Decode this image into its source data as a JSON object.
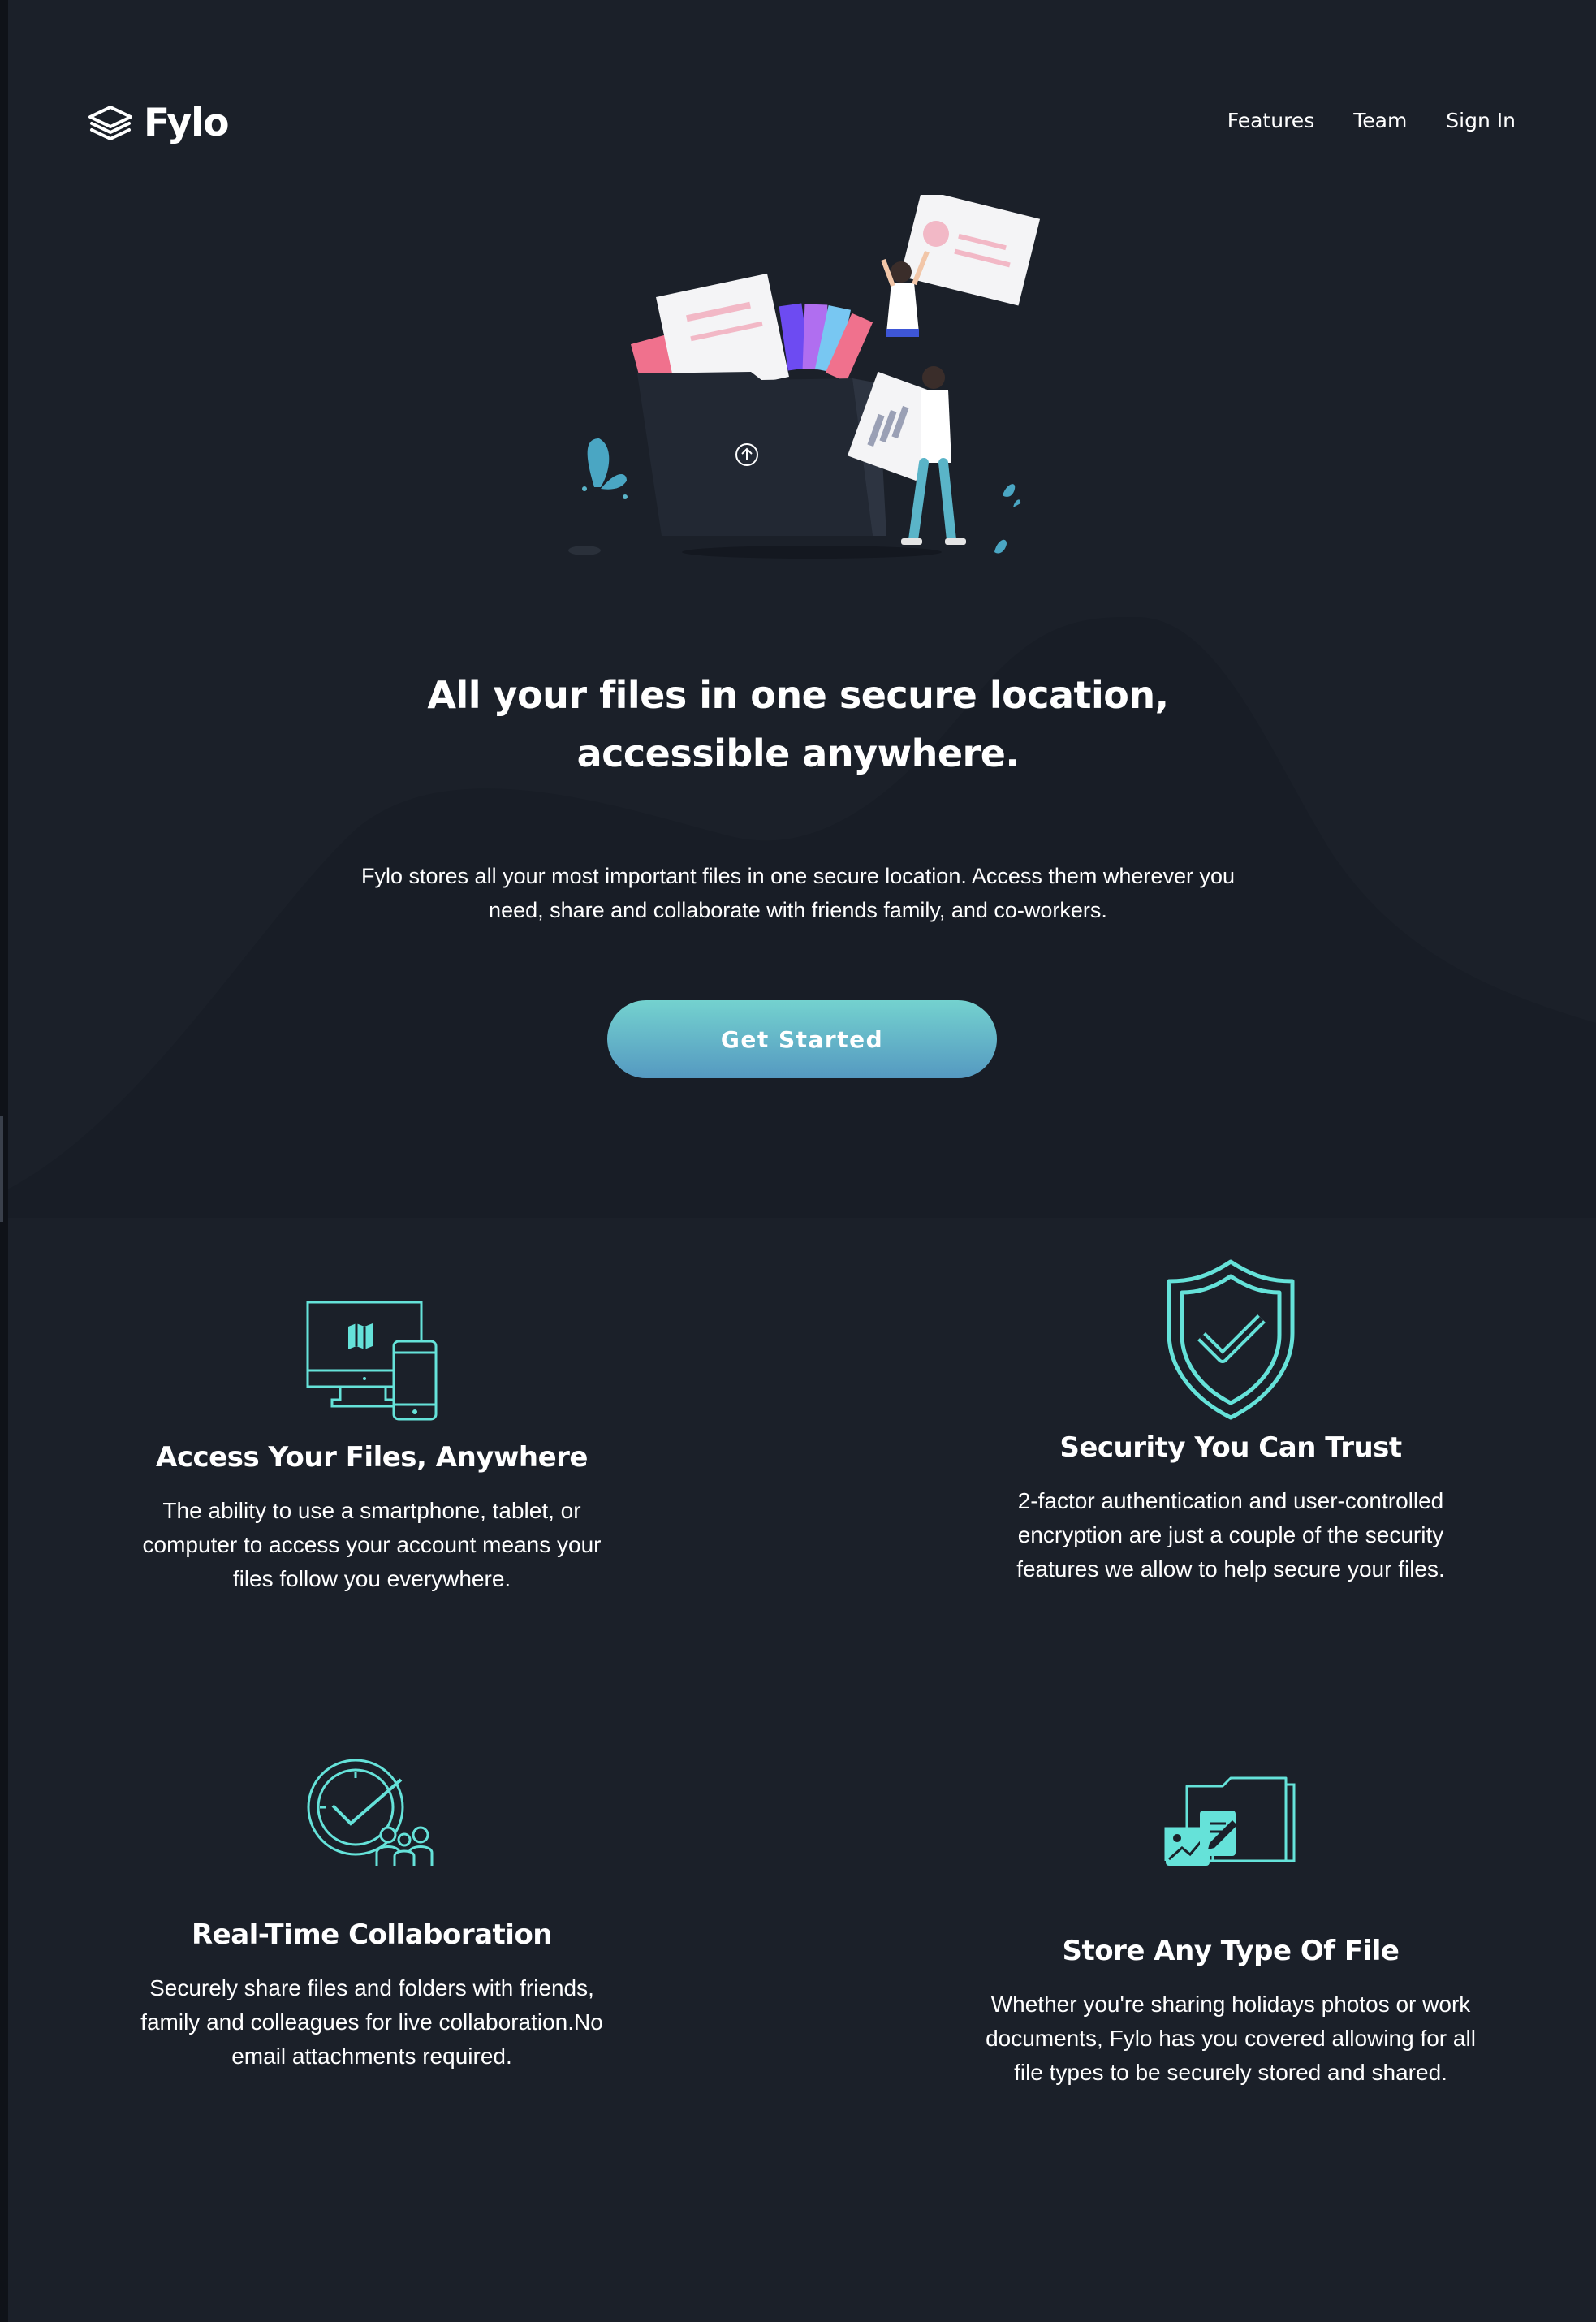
{
  "brand": {
    "name": "Fylo",
    "logo_icon": "layers-icon",
    "accent_color": "#65e2d9",
    "background_color": "#1c2230"
  },
  "nav": {
    "items": [
      {
        "label": "Features"
      },
      {
        "label": "Team"
      },
      {
        "label": "Sign In"
      }
    ]
  },
  "hero": {
    "illustration": "file-upload-illustration",
    "title": "All your files in one secure location, accessible anywhere.",
    "description": "Fylo stores all your most important files in one secure location. Access them wherever you need, share and collaborate with friends family, and co-workers.",
    "cta_label": "Get Started"
  },
  "features": [
    {
      "icon": "devices-icon",
      "title": "Access Your Files, Anywhere",
      "description": "The ability to use a smartphone, tablet, or computer to access your account means your files follow you everywhere."
    },
    {
      "icon": "shield-check-icon",
      "title": "Security You Can Trust",
      "description": "2-factor authentication and user-controlled encryption are just a couple of the security features we allow to help secure your files."
    },
    {
      "icon": "collaboration-icon",
      "title": "Real-Time Collaboration",
      "description": "Securely share files and folders with friends, family and colleagues for live collaboration.No email attachments required."
    },
    {
      "icon": "folder-files-icon",
      "title": "Store Any Type Of File",
      "description": "Whether you're sharing holidays photos or work documents, Fylo has you covered allowing for all file types to be securely stored and shared."
    }
  ]
}
